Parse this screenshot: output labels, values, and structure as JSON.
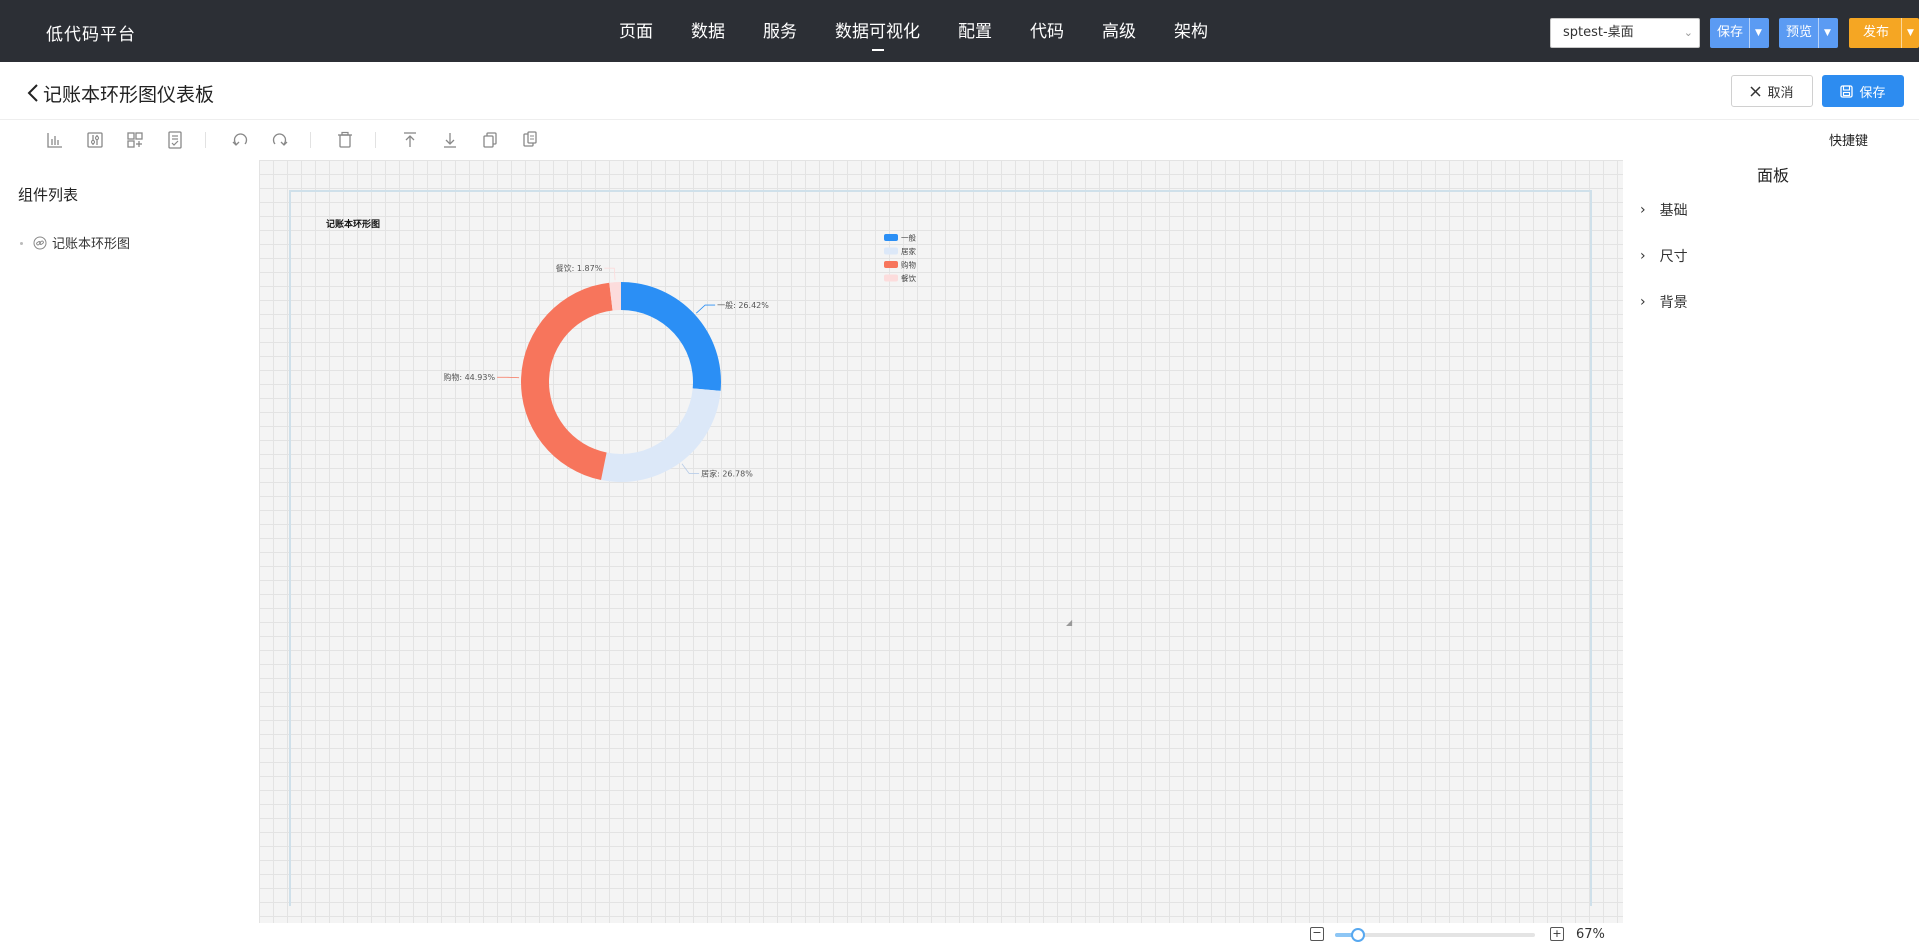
{
  "app": {
    "brand": "低代码平台",
    "nav": [
      "页面",
      "数据",
      "服务",
      "数据可视化",
      "配置",
      "代码",
      "高级",
      "架构"
    ],
    "app_select": "sptest-桌面",
    "save": "保存",
    "preview": "预览",
    "publish": "发布"
  },
  "header": {
    "title": "记账本环形图仪表板",
    "cancel": "取消",
    "save": "保存"
  },
  "toolbar": {
    "shortcut": "快捷键",
    "icons": [
      "bar-chart-icon",
      "adjust-icon",
      "component-icon",
      "report-icon",
      "undo-icon",
      "redo-icon",
      "delete-icon",
      "bring-to-top-icon",
      "send-to-bottom-icon",
      "copy-icon",
      "paste-icon"
    ]
  },
  "left_panel": {
    "title": "组件列表",
    "items": [
      {
        "label": "记账本环形图"
      }
    ]
  },
  "right_panel": {
    "title": "面板",
    "sections": [
      "基础",
      "尺寸",
      "背景"
    ]
  },
  "zoom": {
    "label": "67%",
    "level_percent": 67,
    "min_percent": 50,
    "max_percent": 200
  },
  "colors": {
    "topbar": "#2c2f35",
    "accent": "#2d8cf0",
    "button_blue": "#5b9bf3",
    "button_orange": "#f5a623"
  },
  "chart_data": {
    "type": "pie",
    "title": "记账本环形图",
    "legend": [
      "一般",
      "居家",
      "购物",
      "餐饮"
    ],
    "slices": [
      {
        "name": "一般",
        "value": 26.42,
        "label": "一般: 26.42%",
        "color": "#2b8ff5"
      },
      {
        "name": "居家",
        "value": 26.78,
        "label": "居家: 26.78%",
        "color": "#dce8f8"
      },
      {
        "name": "购物",
        "value": 44.93,
        "label": "购物: 44.93%",
        "color": "#f7755c"
      },
      {
        "name": "餐饮",
        "value": 1.87,
        "label": "餐饮: 1.87%",
        "color": "#fcdcdc"
      }
    ]
  }
}
